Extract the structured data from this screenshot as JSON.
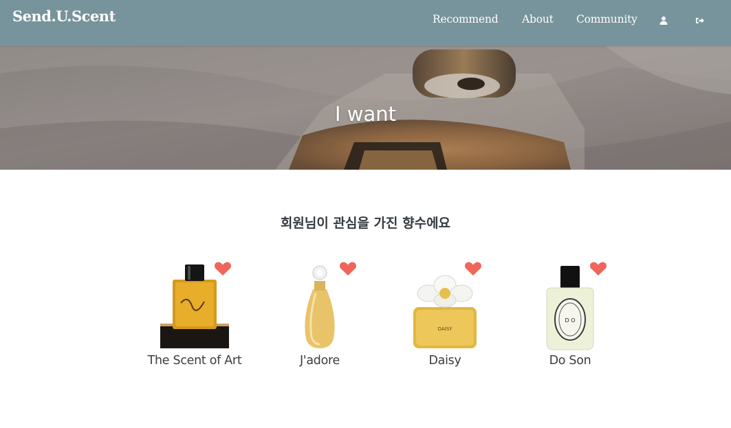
{
  "navbar": {
    "brand": "Send.U.Scent",
    "links": [
      {
        "label": "Recommend"
      },
      {
        "label": "About"
      },
      {
        "label": "Community"
      }
    ],
    "icons": [
      "user-icon",
      "sign-out-icon"
    ],
    "background_color": "#77939b"
  },
  "hero": {
    "title": "I want"
  },
  "main": {
    "heading": "회원님이 관심을 가진 향수에요",
    "products": [
      {
        "name": "The Scent of Art",
        "liked": true
      },
      {
        "name": "J'adore",
        "liked": true
      },
      {
        "name": "Daisy",
        "liked": true
      },
      {
        "name": "Do Son",
        "liked": true
      }
    ],
    "heart_color": "#f0665a"
  }
}
